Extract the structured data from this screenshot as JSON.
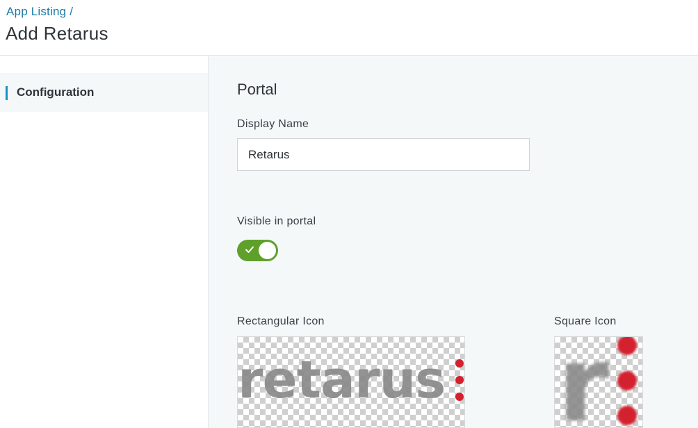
{
  "header": {
    "breadcrumb": "App Listing /",
    "title": "Add Retarus"
  },
  "sidebar": {
    "items": [
      {
        "label": "Configuration",
        "active": true
      }
    ]
  },
  "main": {
    "section_title": "Portal",
    "display_name": {
      "label": "Display Name",
      "value": "Retarus"
    },
    "visible_in_portal": {
      "label": "Visible in portal",
      "enabled": true,
      "color": "#5ea02a"
    },
    "rectangular_icon": {
      "label": "Rectangular Icon",
      "logo_text": "retarus"
    },
    "square_icon": {
      "label": "Square Icon",
      "logo_text": "r"
    }
  },
  "colors": {
    "accent": "#1a7aa8",
    "logo_red": "#d3212f",
    "logo_gray": "#8a8a8a"
  }
}
